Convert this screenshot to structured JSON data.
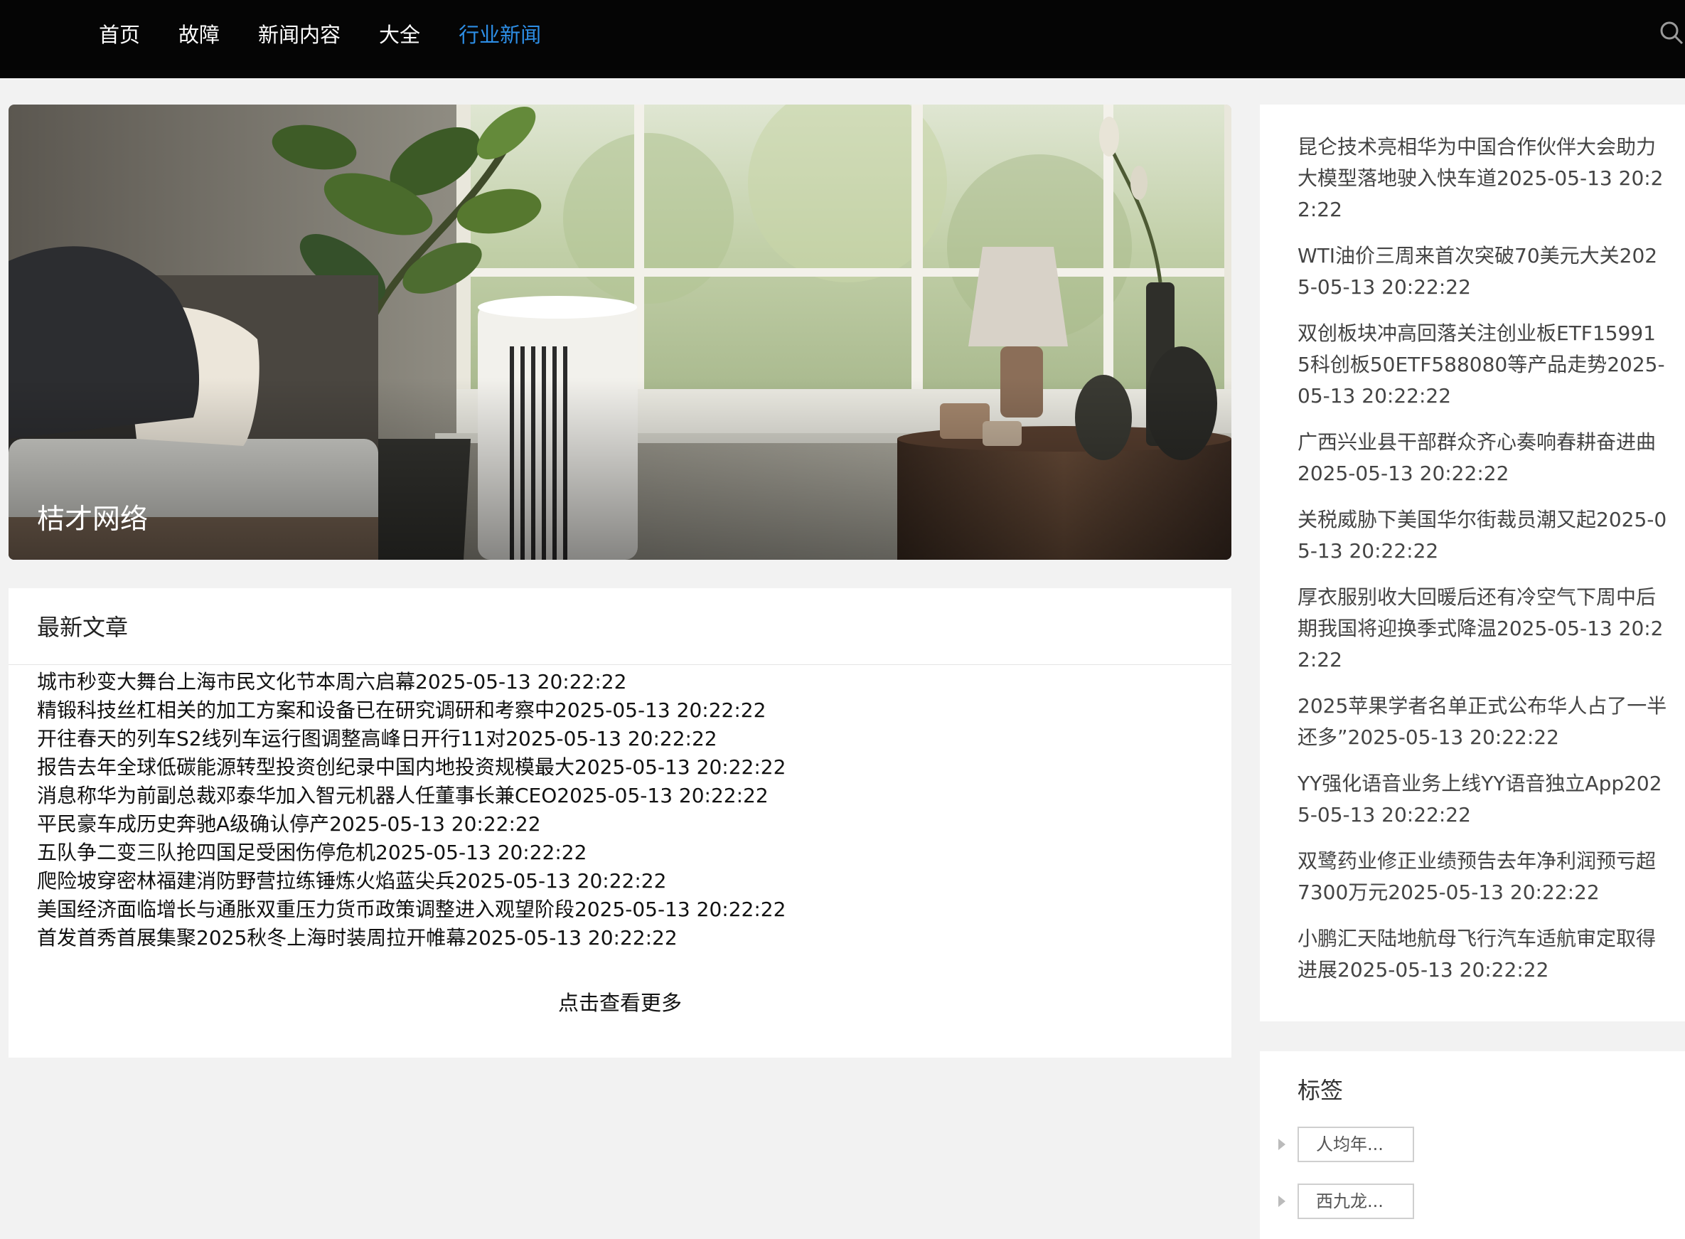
{
  "nav": {
    "items": [
      {
        "label": "首页",
        "active": false
      },
      {
        "label": "故障",
        "active": false
      },
      {
        "label": "新闻内容",
        "active": false
      },
      {
        "label": "大全",
        "active": false
      },
      {
        "label": "行业新闻",
        "active": true
      }
    ],
    "search_icon": "search-icon"
  },
  "hero": {
    "caption": "桔才网络"
  },
  "latest": {
    "title": "最新文章",
    "articles": [
      "城市秒变大舞台上海市民文化节本周六启幕2025-05-13 20:22:22",
      "精锻科技丝杠相关的加工方案和设备已在研究调研和考察中2025-05-13 20:22:22",
      "开往春天的列车S2线列车运行图调整高峰日开行11对2025-05-13 20:22:22",
      "报告去年全球低碳能源转型投资创纪录中国内地投资规模最大2025-05-13 20:22:22",
      "消息称华为前副总裁邓泰华加入智元机器人任董事长兼CEO2025-05-13 20:22:22",
      "平民豪车成历史奔驰A级确认停产2025-05-13 20:22:22",
      "五队争二变三队抢四国足受困伤停危机2025-05-13 20:22:22",
      "爬险坡穿密林福建消防野营拉练锤炼火焰蓝尖兵2025-05-13 20:22:22",
      "美国经济面临增长与通胀双重压力货币政策调整进入观望阶段2025-05-13 20:22:22",
      "首发首秀首展集聚2025秋冬上海时装周拉开帷幕2025-05-13 20:22:22"
    ],
    "more_label": "点击查看更多"
  },
  "side_news": [
    "昆仑技术亮相华为中国合作伙伴大会助力大模型落地驶入快车道2025-05-13 20:22:22",
    "WTI油价三周来首次突破70美元大关2025-05-13 20:22:22",
    "双创板块冲高回落关注创业板ETF159915科创板50ETF588080等产品走势2025-05-13 20:22:22",
    "广西兴业县干部群众齐心奏响春耕奋进曲2025-05-13 20:22:22",
    "关税威胁下美国华尔街裁员潮又起2025-05-13 20:22:22",
    "厚衣服别收大回暖后还有冷空气下周中后期我国将迎换季式降温2025-05-13 20:22:22",
    "2025苹果学者名单正式公布华人占了一半还多”2025-05-13 20:22:22",
    "YY强化语音业务上线YY语音独立App2025-05-13 20:22:22",
    "双鹭药业修正业绩预告去年净利润预亏超7300万元2025-05-13 20:22:22",
    "小鹏汇天陆地航母飞行汽车适航审定取得进展2025-05-13 20:22:22"
  ],
  "tags": {
    "title": "标签",
    "items": [
      "人均年...",
      "西九龙..."
    ]
  },
  "colors": {
    "topbar_bg": "#050505",
    "nav_active": "#2d8ee6",
    "page_bg": "#f2f2f2"
  }
}
